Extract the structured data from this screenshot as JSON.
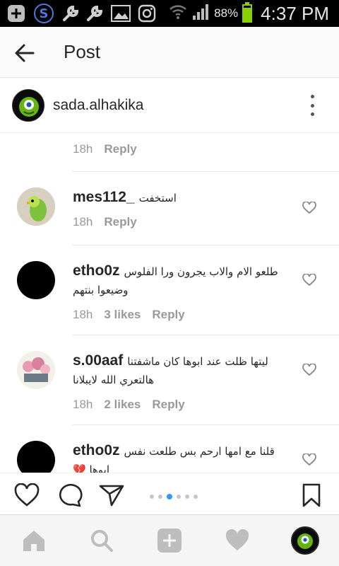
{
  "status_bar": {
    "battery_percent": "88%",
    "battery_level": 0.88,
    "time": "4:37 PM",
    "icons": [
      "add-icon",
      "s-app-icon",
      "wrench-icon",
      "wrench-icon",
      "image-icon",
      "instagram-icon",
      "wifi-icon",
      "signal-icon",
      "battery-icon"
    ]
  },
  "header": {
    "title": "Post",
    "back_icon": "arrow-left-icon"
  },
  "owner": {
    "username": "sada.alhakika",
    "more_icon": "more-vertical-icon"
  },
  "comments": [
    {
      "username": "",
      "text": "",
      "time": "18h",
      "likes": "",
      "reply": "Reply"
    },
    {
      "username": "mes112_",
      "text": "استخفت",
      "text2": "",
      "time": "18h",
      "likes": "",
      "reply": "Reply"
    },
    {
      "username": "etho0z",
      "text": "طلعو الام والاب يجرون ورا الفلوس",
      "text2": "وضيعوا بنتهم",
      "time": "18h",
      "likes": "3 likes",
      "reply": "Reply"
    },
    {
      "username": "s.00aaf",
      "text": "ليتها ظلت عند ابوها كان ماشفتنا",
      "text2": "هالتعري الله لايبلانا",
      "time": "18h",
      "likes": "2 likes",
      "reply": "Reply"
    },
    {
      "username": "etho0z",
      "text": "قلنا مع امها ارحم بس طلعت نفس",
      "text2": "ابوها 💔",
      "time": "",
      "likes": "",
      "reply": ""
    }
  ],
  "action_bar": {
    "icons": [
      "heart-outline-icon",
      "comment-icon",
      "send-icon",
      "bookmark-icon"
    ],
    "pager_count": 6,
    "pager_active": 2,
    "accent": "#3897f0"
  },
  "tab_bar": {
    "icons": [
      "home-icon",
      "search-icon",
      "add-icon",
      "heart-icon",
      "profile-avatar"
    ]
  },
  "colors": {
    "text": "#262626",
    "meta": "#999999",
    "accent": "#3897f0",
    "battery": "#8ad000"
  }
}
